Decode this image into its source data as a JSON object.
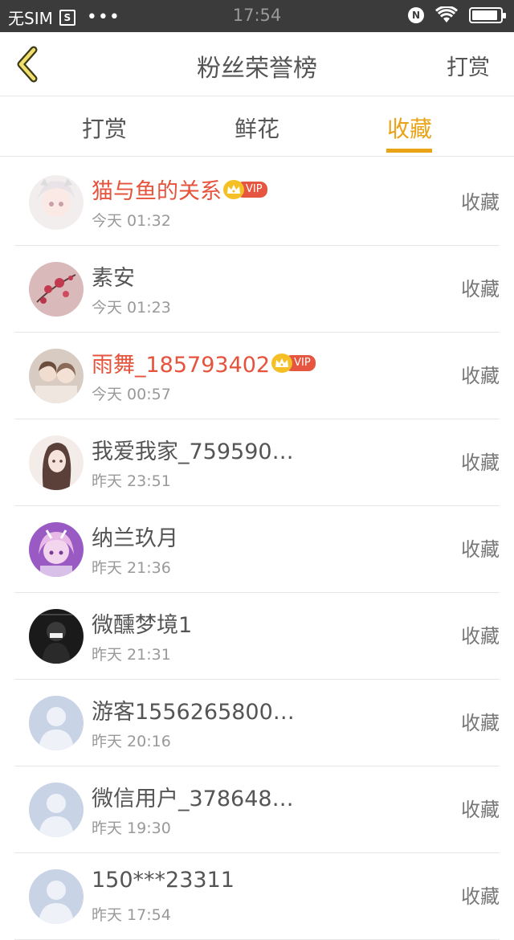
{
  "status_bar": {
    "carrier": "无SIM",
    "sim_icon_text": "S",
    "dots": "•••",
    "time": "17:54",
    "nfc_icon_text": "N",
    "battery_level": 0.9
  },
  "nav": {
    "title": "粉丝荣誉榜",
    "action": "打赏"
  },
  "tabs": [
    {
      "label": "打赏",
      "active": false
    },
    {
      "label": "鲜花",
      "active": false
    },
    {
      "label": "收藏",
      "active": true
    }
  ],
  "fans": [
    {
      "name": "猫与鱼的关系",
      "vip": true,
      "time": "今天 01:32",
      "type": "收藏",
      "avatar": "anime-girl-avatar"
    },
    {
      "name": "素安",
      "vip": false,
      "time": "今天 01:23",
      "type": "收藏",
      "avatar": "flower-avatar"
    },
    {
      "name": "雨舞_185793402",
      "vip": true,
      "time": "今天 00:57",
      "type": "收藏",
      "avatar": "photo-girl-avatar"
    },
    {
      "name": "我爱我家_759590…",
      "vip": false,
      "time": "昨天 23:51",
      "type": "收藏",
      "avatar": "long-hair-girl-avatar"
    },
    {
      "name": "纳兰玖月",
      "vip": false,
      "time": "昨天 21:36",
      "type": "收藏",
      "avatar": "purple-anime-avatar"
    },
    {
      "name": "微醺梦境1",
      "vip": false,
      "time": "昨天 21:31",
      "type": "收藏",
      "avatar": "dark-figure-avatar"
    },
    {
      "name": "游客1556265800…",
      "vip": false,
      "time": "昨天 20:16",
      "type": "收藏",
      "avatar": "default-avatar"
    },
    {
      "name": "微信用户_378648…",
      "vip": false,
      "time": "昨天 19:30",
      "type": "收藏",
      "avatar": "default-avatar"
    },
    {
      "name": "150***23311",
      "vip": false,
      "time": "昨天 17:54",
      "type": "收藏",
      "avatar": "default-avatar"
    }
  ],
  "vip_label": "VIP",
  "colors": {
    "accent": "#e8a317",
    "vip_name": "#e5533c",
    "vip_pill": "#e5553f",
    "crown": "#f5c026",
    "status_bar": "#3b3b3b",
    "default_avatar": "#c9d3e6"
  }
}
